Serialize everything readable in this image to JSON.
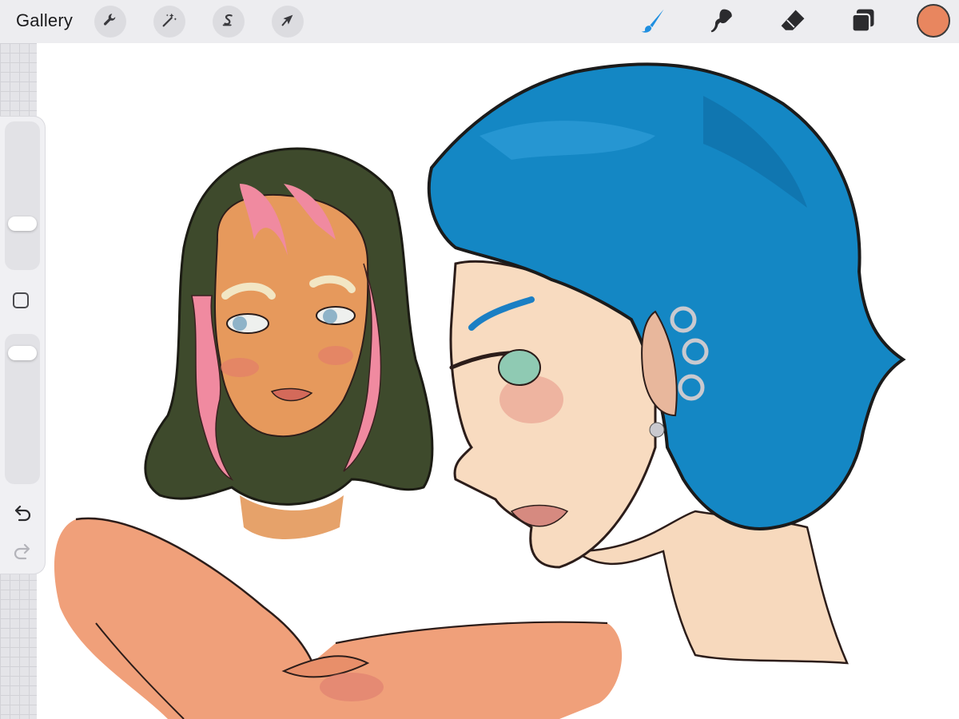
{
  "app": {
    "gallery_label": "Gallery"
  },
  "toolbar": {
    "left_tools": [
      {
        "name": "actions",
        "icon": "wrench-icon"
      },
      {
        "name": "adjustments",
        "icon": "magic-wand-icon"
      },
      {
        "name": "selection",
        "icon": "selection-s-icon"
      },
      {
        "name": "transform",
        "icon": "arrow-cursor-icon"
      }
    ],
    "right_tools": [
      {
        "name": "brush",
        "icon": "brush-icon",
        "active": true
      },
      {
        "name": "smudge",
        "icon": "smudge-icon"
      },
      {
        "name": "eraser",
        "icon": "eraser-icon"
      },
      {
        "name": "layers",
        "icon": "layers-icon"
      }
    ],
    "current_color": "#e8865f",
    "active_tool_color": "#1f8fe0"
  },
  "sidebar": {
    "brush_size": 0.28,
    "brush_opacity": 0.93,
    "icons": [
      "modify-square-icon",
      "undo-icon",
      "redo-icon"
    ]
  },
  "canvas": {
    "background": "#ffffff"
  }
}
